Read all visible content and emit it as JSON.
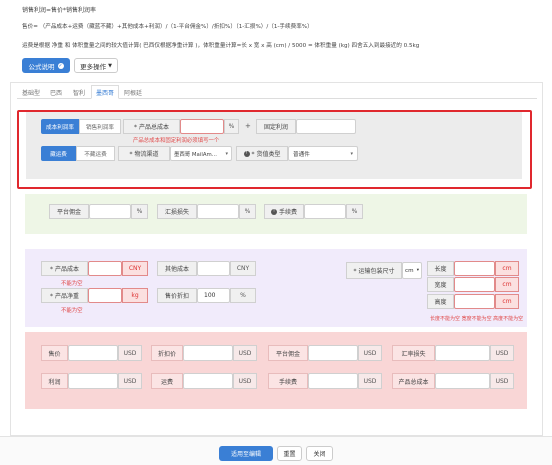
{
  "header": {
    "formula_title": "销售利润=售价*销售利润率",
    "formula_line": "售价= （产品成本+运费（藏蓝不藏）+其他成本+利润）/（1-平台佣金%）/折扣%）（1-汇损%）/（1-手续费率%）",
    "note_line": "运费是根据 净重 和 体积重量之间的较大值计算( 巴西仅根据净重计算 )，体积重量计算=长 x 宽 x 高 (cm) / 5000 = 体积重量 (kg) 四舍五入到最接近的 0.5kg",
    "formula_btn": "公式说明",
    "more_btn": "更多操作"
  },
  "tabs": [
    "基础型",
    "巴西",
    "智利",
    "墨西哥",
    "阿根廷"
  ],
  "active_tab_index": 3,
  "pricing": {
    "mode_active": "成本利润率",
    "mode_inactive": "销售利润率",
    "total_cost_label": "* 产品总成本",
    "total_cost_unit": "%",
    "plus": "+",
    "fixed_profit_label": "固定利润",
    "error_hint": "产品总成本和固定利润必须填写一个",
    "ship_active": "藏运费",
    "ship_inactive": "不藏运费",
    "channel_label": "* 物流渠道",
    "channel_value": "墨西哥 MailAm...",
    "goods_type_label": "* 货值类型",
    "goods_type_value": "普通件"
  },
  "fees": {
    "platform_label": "平台佣金",
    "platform_unit": "%",
    "fx_label": "汇损损失",
    "fx_unit": "%",
    "handling_label": "手续费",
    "handling_unit": "%"
  },
  "product": {
    "cost_label": "* 产品成本",
    "cost_unit": "CNY",
    "cost_error": "不能为空",
    "other_cost_label": "其他成本",
    "other_cost_unit": "CNY",
    "weight_label": "* 产品净重",
    "weight_unit": "kg",
    "weight_error": "不能为空",
    "discount_label": "售价折扣",
    "discount_value": "100",
    "discount_unit": "%",
    "dim_label": "* 运输包装尺寸",
    "dim_unit_select": "cm",
    "length_label": "长度",
    "width_label": "宽度",
    "height_label": "高度",
    "dim_field_unit": "cm",
    "dim_error": "长度不能为空  宽度不能为空  高度不能为空"
  },
  "results": {
    "row1": [
      {
        "label": "售价",
        "unit": "USD"
      },
      {
        "label": "折扣价",
        "unit": "USD"
      },
      {
        "label": "平台佣金",
        "unit": "USD"
      },
      {
        "label": "汇率损失",
        "unit": "USD"
      }
    ],
    "row2": [
      {
        "label": "利润",
        "unit": "USD"
      },
      {
        "label": "运费",
        "unit": "USD"
      },
      {
        "label": "手续费",
        "unit": "USD"
      },
      {
        "label": "产品总成本",
        "unit": "USD"
      }
    ]
  },
  "footer": {
    "apply_btn": "适用至编辑",
    "reset_btn": "重置",
    "close_btn": "关闭"
  },
  "colors": {
    "accent": "#3a7fd5",
    "highlight_border": "#e0282e",
    "fees_bg": "#eef6e6",
    "product_bg": "#f1ebfb",
    "results_bg": "#f9d6d6"
  }
}
